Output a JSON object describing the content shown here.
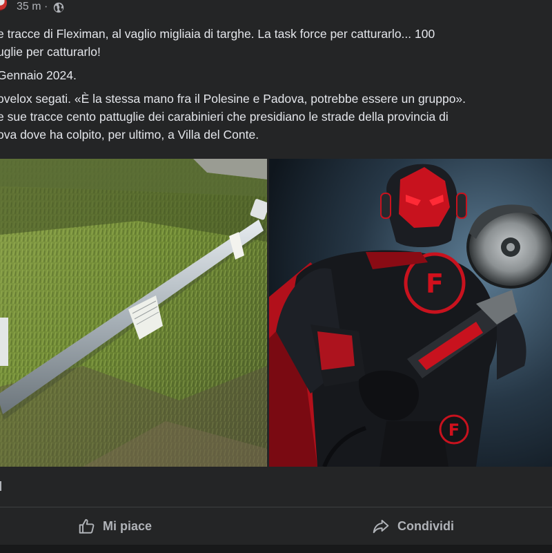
{
  "post": {
    "time": "35 m ·",
    "text_lines_1": [
      "e tracce di Fleximan, al vaglio migliaia di targhe. La task force per catturarlo...  100",
      "uglie per catturarlo!"
    ],
    "text_lines_2": [
      "Gennaio 2024."
    ],
    "text_lines_3": [
      "ovelox segati. «È la stessa mano fra il Polesine e Padova, potrebbe essere un gruppo».",
      "e sue tracce cento pattuglie dei carabinieri che presidiano le strade della provincia di",
      "ova dove ha colpito, per ultimo, a Villa del Conte."
    ]
  },
  "images": {
    "right_emblem_letter": "F"
  },
  "actions": {
    "like_label": "Mi piace",
    "share_label": "Condividi"
  },
  "colors": {
    "background": "#242526",
    "text": "#e4e6eb",
    "muted": "#b0b3b8",
    "accent_red": "#d0101c"
  }
}
